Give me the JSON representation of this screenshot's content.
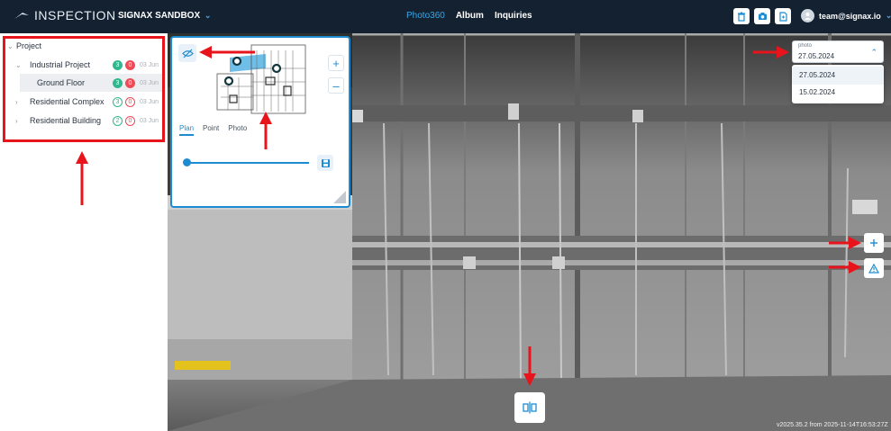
{
  "header": {
    "app_title": "INSPECTION",
    "workspace": "SIGNAX SANDBOX",
    "nav": [
      "Photo360",
      "Album",
      "Inquiries"
    ],
    "user_email": "team@signax.io",
    "icons": [
      "delete-icon",
      "camera-icon",
      "document-icon"
    ]
  },
  "tree": {
    "root": "Project",
    "items": [
      {
        "label": "Industrial Project",
        "green": "3",
        "red": "0",
        "date": "03 Jun"
      },
      {
        "label": "Ground Floor",
        "green": "3",
        "red": "0",
        "date": "03 Jun"
      },
      {
        "label": "Residential Complex",
        "green": "3",
        "red": "0",
        "date": "03 Jun"
      },
      {
        "label": "Residential Building",
        "green": "2",
        "red": "0",
        "date": "03 Jun"
      }
    ]
  },
  "minimap": {
    "tabs": [
      "Plan",
      "Point",
      "Photo"
    ],
    "active_tab": "Plan",
    "slider_value": 0
  },
  "photo_select": {
    "label": "photo",
    "value": "27.05.2024",
    "options": [
      "27.05.2024",
      "15.02.2024"
    ]
  },
  "version_text": "v2025.35.2 from 2025-11-14T16:53:27Z",
  "colors": {
    "header_bg": "#142131",
    "accent": "#1d8bd1",
    "annotation": "#e8141b",
    "badge_green": "#31b78d",
    "badge_red": "#ef4b56"
  }
}
